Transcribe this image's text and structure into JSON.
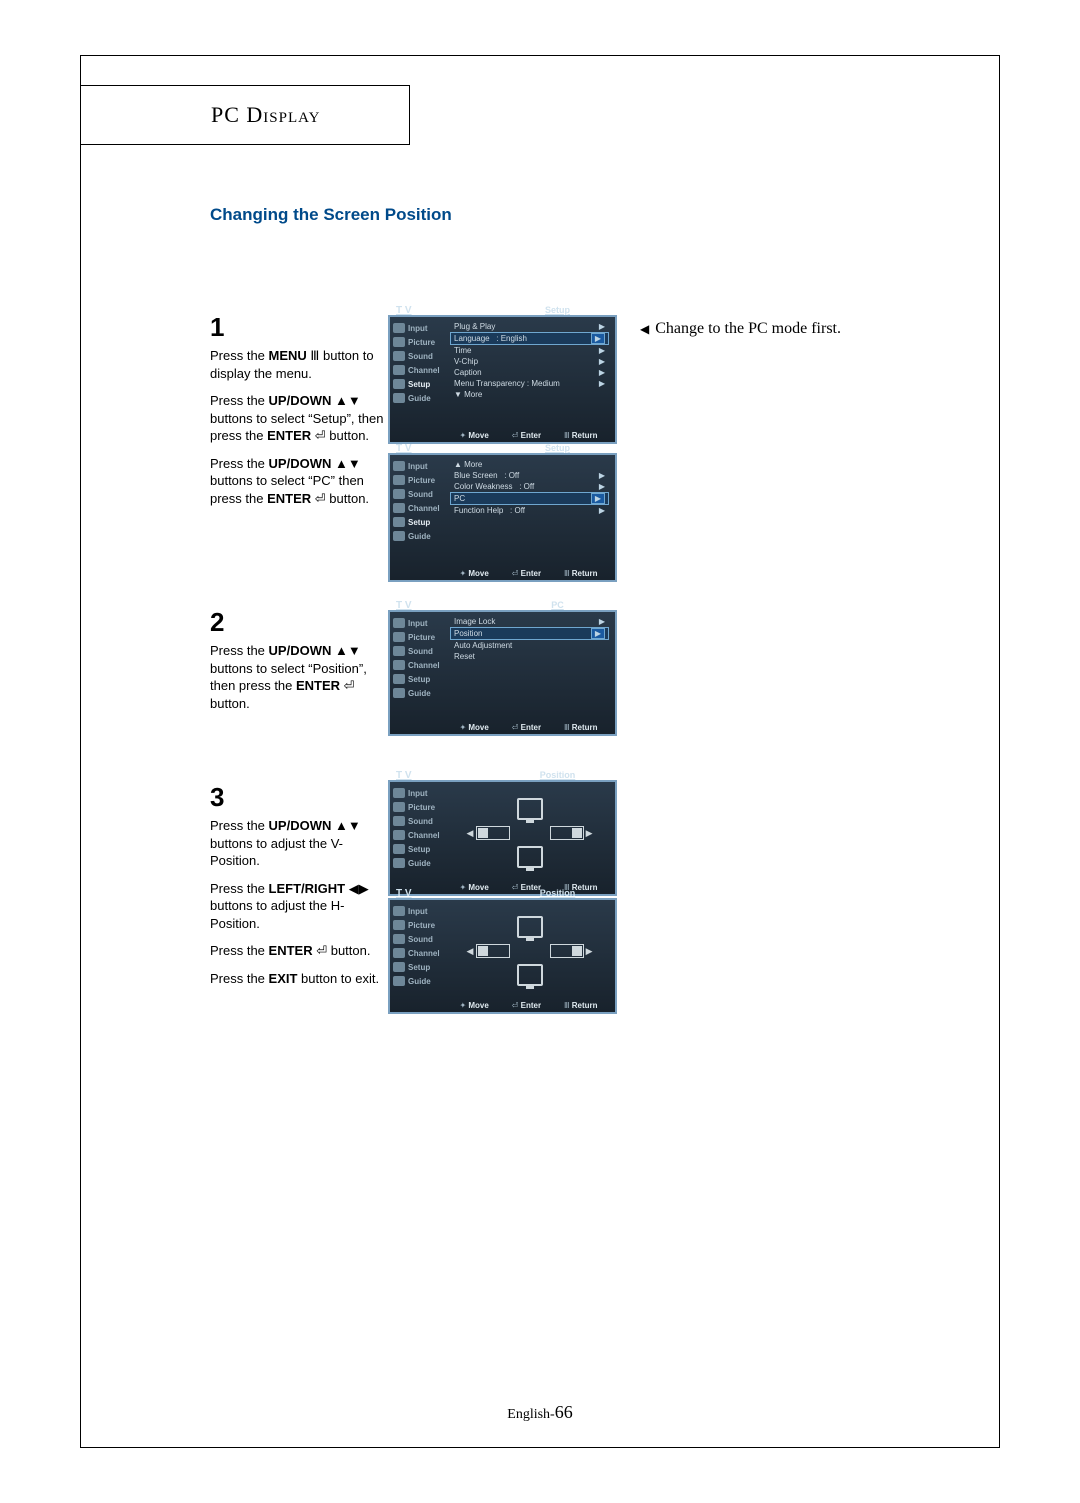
{
  "page": {
    "section_title": "PC Display",
    "heading": "Changing the Screen Position",
    "note": "Change to the PC mode first.",
    "footer_prefix": "English-",
    "footer_page": "66"
  },
  "steps": {
    "s1": {
      "num": "1",
      "p1a": "Press the ",
      "p1b": "MENU",
      "p1c": " button to display the menu.",
      "p2a": "Press the ",
      "p2b": "UP/DOWN",
      "p2c": " buttons to select “Setup”, then press the ",
      "p2d": "ENTER",
      "p2e": " button.",
      "p3a": "Press the ",
      "p3b": "UP/DOWN",
      "p3c": " buttons to select “PC” then press the ",
      "p3d": "ENTER",
      "p3e": " button."
    },
    "s2": {
      "num": "2",
      "p1a": "Press the ",
      "p1b": "UP/DOWN",
      "p1c": " buttons to select “Position”, then press the ",
      "p1d": "ENTER",
      "p1e": " button."
    },
    "s3": {
      "num": "3",
      "p1a": "Press the ",
      "p1b": "UP/DOWN",
      "p1c": " buttons to adjust the V-Position.",
      "p2a": "Press the ",
      "p2b": "LEFT/RIGHT",
      "p2c": " buttons to adjust the H-Position.",
      "p3a": "Press the ",
      "p3b": "ENTER",
      "p3c": " button.",
      "p4a": "Press the ",
      "p4b": "EXIT",
      "p4c": " button to exit."
    }
  },
  "osd": {
    "tv": "T V",
    "side": {
      "input": "Input",
      "picture": "Picture",
      "sound": "Sound",
      "channel": "Channel",
      "setup": "Setup",
      "guide": "Guide"
    },
    "foot": {
      "move_ud": "Move",
      "move_all": "Move",
      "enter": "Enter",
      "return": "Return"
    },
    "setup1": {
      "title": "Setup",
      "plug": "Plug & Play",
      "language": "Language",
      "language_val": ": English",
      "time": "Time",
      "vchip": "V-Chip",
      "caption": "Caption",
      "menutrans": "Menu Transparency : Medium",
      "more": "▼  More"
    },
    "setup2": {
      "title": "Setup",
      "more": "▲  More",
      "blue": "Blue Screen",
      "blue_val": ": Off",
      "colorw": "Color Weakness",
      "colorw_val": ": Off",
      "pc": "PC",
      "fh": "Function Help",
      "fh_val": ": Off"
    },
    "pc": {
      "title": "PC",
      "imglock": "Image Lock",
      "position": "Position",
      "auto": "Auto Adjustment",
      "reset": "Reset"
    },
    "position": {
      "title": "Position"
    }
  }
}
